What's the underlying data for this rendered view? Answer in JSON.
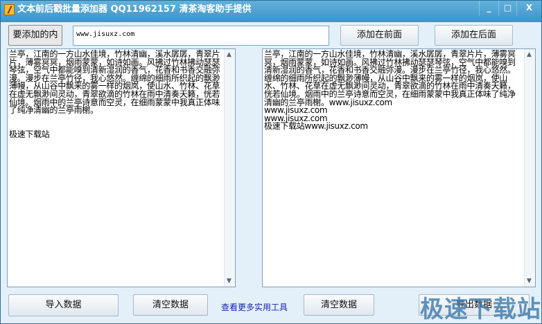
{
  "window": {
    "title": "文本前后戳批量添加器 QQ11962157 清茶淘客助手提供",
    "minimize": "_",
    "maximize": "□",
    "close": "X"
  },
  "toolbar": {
    "content_label": "要添加的内容",
    "content_value": "www.jisuxz.com",
    "prepend_button": "添加在前面",
    "append_button": "添加在后面"
  },
  "input_text": "兰亭，江南的一方山水佳境，竹林清幽，溪水孱孱，青翠片片，薄雾冥冥，烟雨蒙蒙，如诗如画。风拂过竹林拂动瑟瑟琴弦，空气中都能嗅到清新湿润的香气，花香和书香交融弥漫。漫步在兰亭竹径，我心悠然。缠绵的细雨所织起的飘渺薄幔，从山谷中飘来的雾一样的烟岚，使山水、竹林、花草在虚无飘渺间灵动，青翠欲滴的竹林在雨中清奏天籁，恍若仙境。烟雨中的兰亭诗意而空灵，在细雨蒙蒙中我真正体味了纯净清幽的兰亭雨榭。\n\n\n极速下载站",
  "output_text": "兰亭，江南的一方山水佳境，竹林清幽，溪水孱孱，青翠片片，薄雾冥冥，烟雨蒙蒙，如诗如画。风拂过竹林拂动瑟瑟琴弦，空气中都能嗅到清新湿润的香气，花香和书香交融弥漫。漫步在兰亭竹径，我心悠然。缠绵的细雨所织起的飘渺薄幔，从山谷中飘来的雾一样的烟岚，使山水、竹林、花草在虚无飘渺间灵动，青翠欲滴的竹林在雨中清奏天籁，恍若仙境。烟雨中的兰亭诗意而空灵，在细雨蒙蒙中我真正体味了纯净清幽的兰亭雨榭。www.jisuxz.com\nwww.jisuxz.com\nwww.jisuxz.com\n极速下载站www.jisuxz.com",
  "bottom": {
    "import_button": "导入数据",
    "clear_left_button": "清空数据",
    "more_tools_link": "查看更多实用工具",
    "clear_right_button": "清空数据",
    "export_button": "导出数据"
  },
  "watermark": "极速下载站"
}
